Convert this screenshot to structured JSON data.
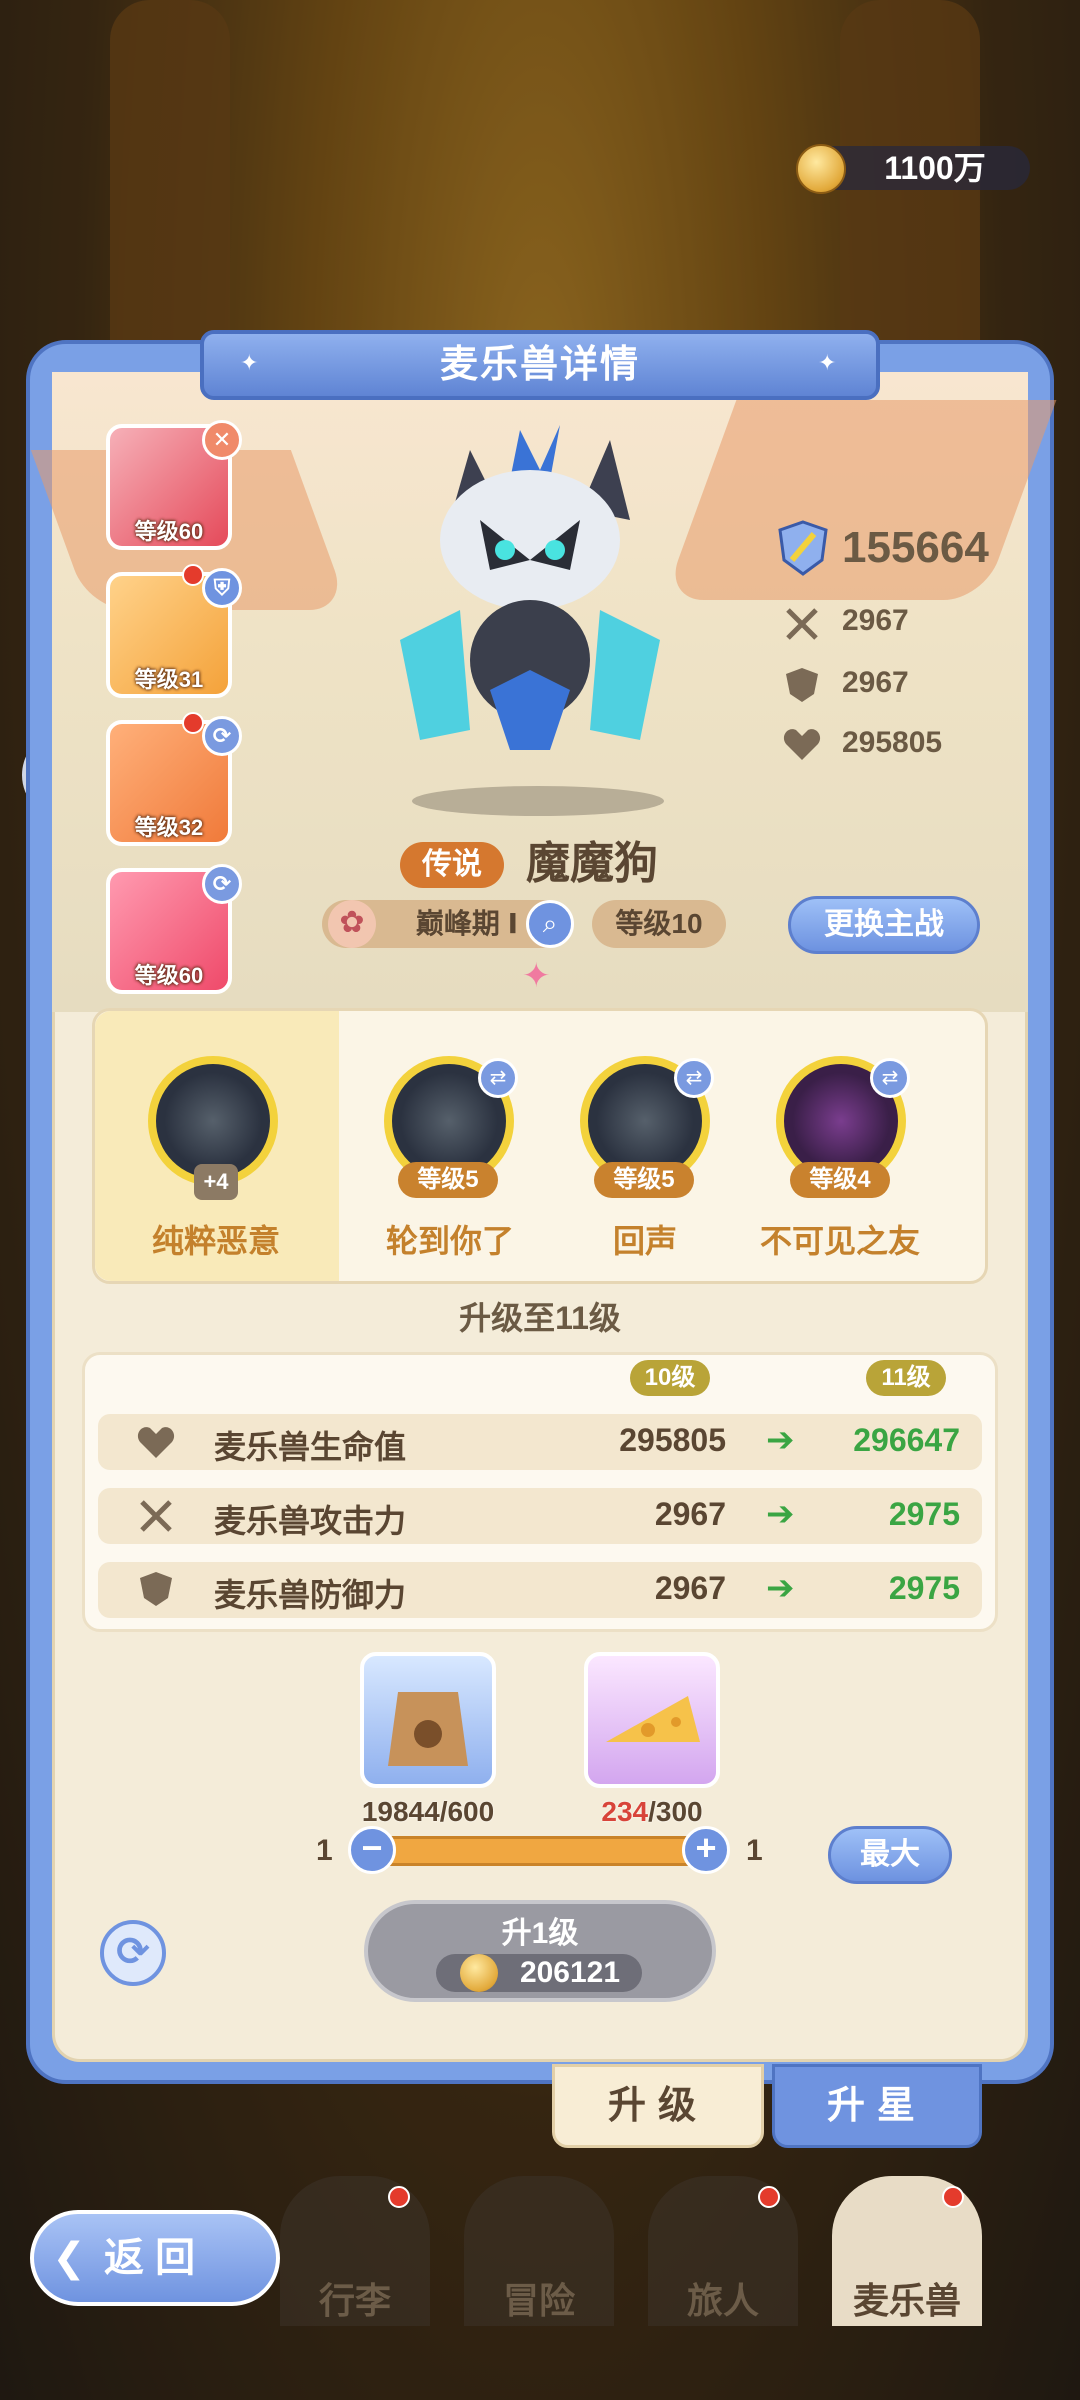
{
  "currency": {
    "gold": "1100万",
    "icon": "coin-icon"
  },
  "panel": {
    "title": "麦乐兽详情"
  },
  "team_slots": [
    {
      "level": "等级60",
      "badge": "✕",
      "badge_color": "#f08a6a",
      "color": "#e54a5a"
    },
    {
      "level": "等级31",
      "badge": "⛨",
      "badge_color": "#6f93e0",
      "color": "#f4a23a"
    },
    {
      "level": "等级32",
      "badge": "⟳",
      "badge_color": "#7a9ae0",
      "color": "#f07a3a"
    },
    {
      "level": "等级60",
      "badge": "⟳",
      "badge_color": "#7a9ae0",
      "color": "#ef4a6a"
    }
  ],
  "stats": {
    "power": "155664",
    "attack": "2967",
    "defense": "2967",
    "hp": "295805"
  },
  "pet": {
    "rarity": "传说",
    "name": "魔魔狗",
    "stage": "巅峰期 Ⅰ",
    "level": "等级10",
    "change_button": "更换主战"
  },
  "skills": [
    {
      "name": "纯粹恶意",
      "level": "+4",
      "selected": true
    },
    {
      "name": "轮到你了",
      "level": "等级5"
    },
    {
      "name": "回声",
      "level": "等级5"
    },
    {
      "name": "不可见之友",
      "level": "等级4"
    }
  ],
  "upgrade": {
    "title": "升级至11级",
    "current_tag": "10级",
    "next_tag": "11级",
    "rows": [
      {
        "label": "麦乐兽生命值",
        "current": "295805",
        "next": "296647",
        "icon": "heart-icon"
      },
      {
        "label": "麦乐兽攻击力",
        "current": "2967",
        "next": "2975",
        "icon": "swords-icon"
      },
      {
        "label": "麦乐兽防御力",
        "current": "2967",
        "next": "2975",
        "icon": "shield-icon"
      }
    ]
  },
  "materials": [
    {
      "have": "19844",
      "need": "/600",
      "icon": "pet-food-bag-icon"
    },
    {
      "have": "234",
      "need": "/300",
      "icon": "cheese-icon"
    }
  ],
  "slider": {
    "min": "1",
    "max": "1",
    "max_button": "最大"
  },
  "upgrade_button": {
    "label": "升1级",
    "cost": "206121"
  },
  "tabs": {
    "upgrade": "升级",
    "star": "升星"
  },
  "nav": {
    "back": "返 回",
    "items": [
      "行李",
      "冒险",
      "旅人",
      "麦乐兽"
    ]
  }
}
